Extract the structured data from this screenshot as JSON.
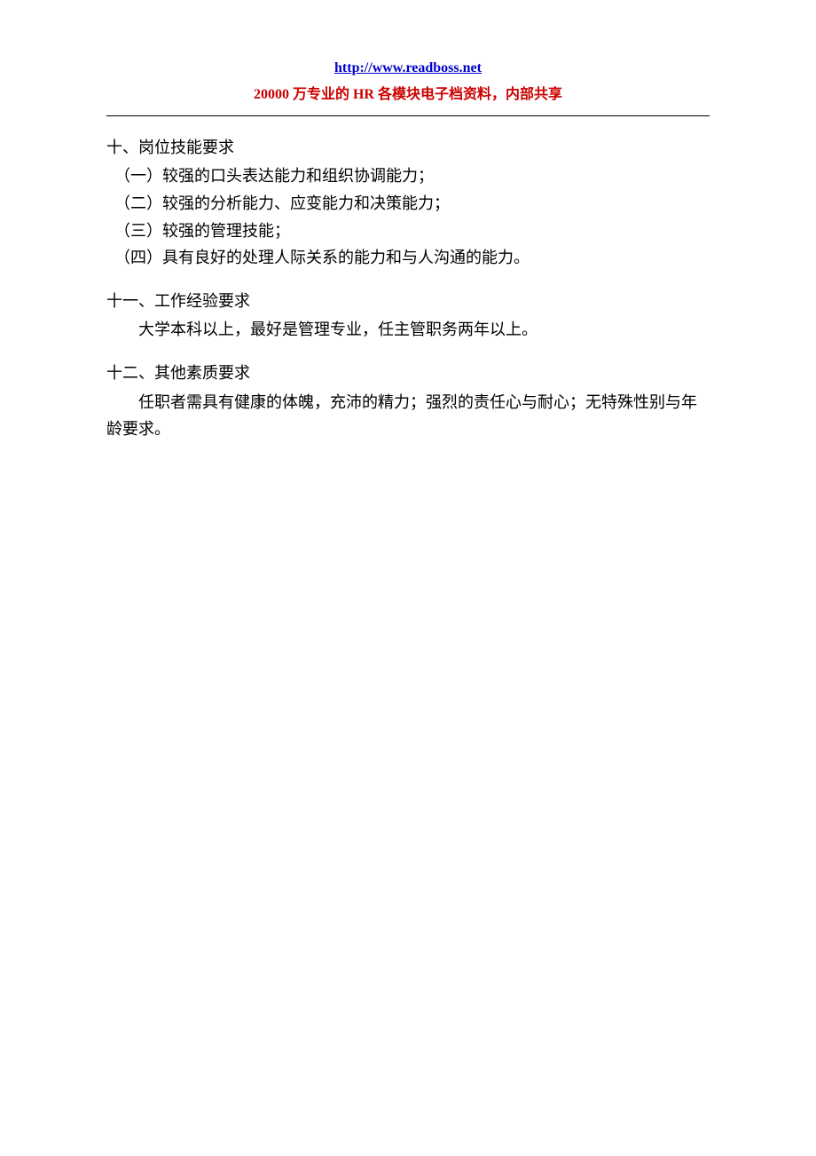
{
  "header": {
    "link_text": "http://www.readboss.net",
    "subtitle": "20000 万专业的 HR 各模块电子档资料，内部共享"
  },
  "sections": {
    "s10": {
      "title": "十、岗位技能要求",
      "items": [
        "（一）较强的口头表达能力和组织协调能力；",
        "（二）较强的分析能力、应变能力和决策能力；",
        "（三）较强的管理技能；",
        "（四）具有良好的处理人际关系的能力和与人沟通的能力。"
      ]
    },
    "s11": {
      "title": "十一、工作经验要求",
      "body": "大学本科以上，最好是管理专业，任主管职务两年以上。"
    },
    "s12": {
      "title": "十二、其他素质要求",
      "body": "任职者需具有健康的体魄，充沛的精力；强烈的责任心与耐心；无特殊性别与年龄要求。"
    }
  }
}
